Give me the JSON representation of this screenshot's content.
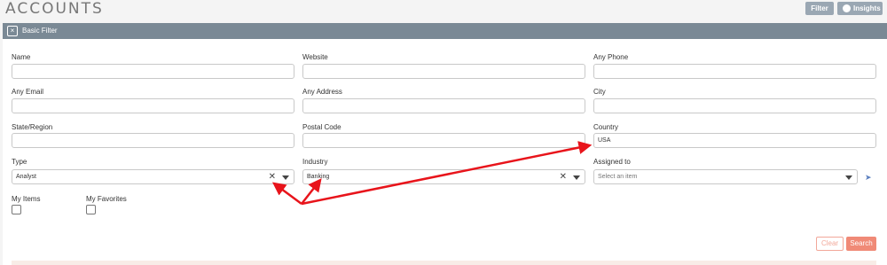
{
  "header": {
    "title": "ACCOUNTS",
    "filter_button": "Filter",
    "insights_button": "Insights"
  },
  "filter_bar": {
    "label": "Basic Filter"
  },
  "fields": {
    "name": {
      "label": "Name",
      "value": ""
    },
    "website": {
      "label": "Website",
      "value": ""
    },
    "any_phone": {
      "label": "Any Phone",
      "value": ""
    },
    "any_email": {
      "label": "Any Email",
      "value": ""
    },
    "any_address": {
      "label": "Any Address",
      "value": ""
    },
    "city": {
      "label": "City",
      "value": ""
    },
    "state_region": {
      "label": "State/Region",
      "value": ""
    },
    "postal_code": {
      "label": "Postal Code",
      "value": ""
    },
    "country": {
      "label": "Country",
      "value": "USA"
    },
    "type": {
      "label": "Type",
      "value": "Analyst"
    },
    "industry": {
      "label": "Industry",
      "value": "Banking"
    },
    "assigned_to": {
      "label": "Assigned to",
      "placeholder": "Select an item"
    }
  },
  "checkboxes": {
    "my_items": {
      "label": "My Items",
      "checked": false
    },
    "my_favorites": {
      "label": "My Favorites",
      "checked": false
    }
  },
  "actions": {
    "clear": "Clear",
    "search": "Search"
  },
  "colors": {
    "bar": "#7a8995",
    "search_button": "#f08a77",
    "annotation_arrow": "#e8141b"
  },
  "icons": [
    "close-icon",
    "info-icon",
    "clear-x-icon",
    "caret-down-icon",
    "pointer-icon"
  ]
}
